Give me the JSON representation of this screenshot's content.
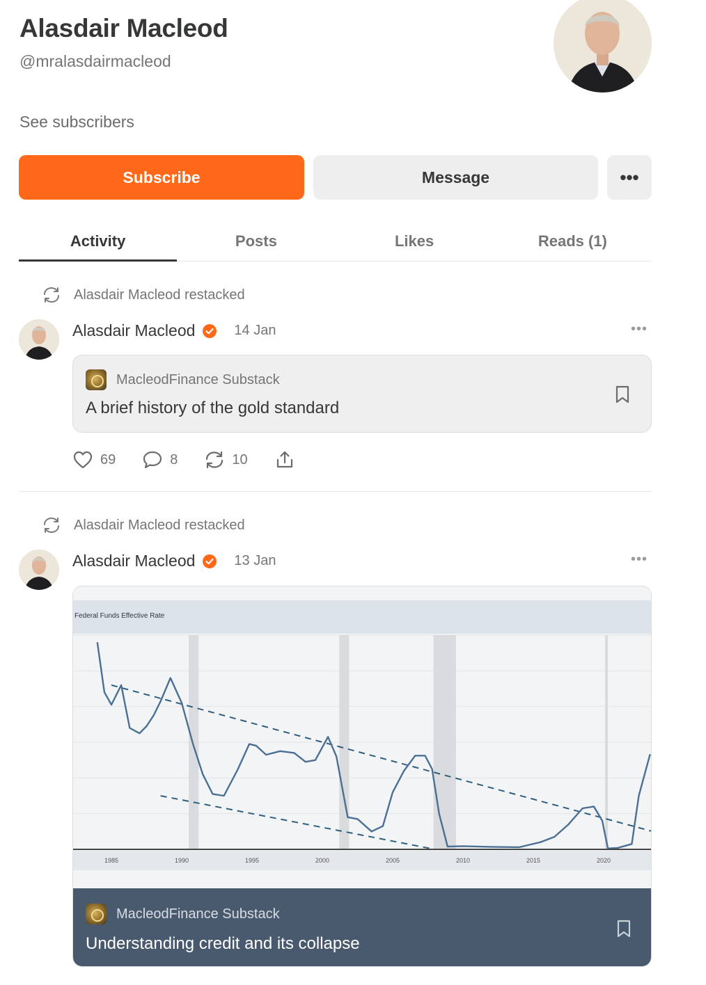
{
  "profile": {
    "name": "Alasdair Macleod",
    "handle": "@mralasdairmacleod",
    "see_subscribers": "See subscribers"
  },
  "buttons": {
    "subscribe": "Subscribe",
    "message": "Message",
    "more": "•••"
  },
  "tabs": [
    {
      "label": "Activity",
      "active": true
    },
    {
      "label": "Posts",
      "active": false
    },
    {
      "label": "Likes",
      "active": false
    },
    {
      "label": "Reads (1)",
      "active": false
    }
  ],
  "feed": [
    {
      "restack_text": "Alasdair Macleod restacked",
      "author": "Alasdair Macleod",
      "date": "14 Jan",
      "publication": "MacleodFinance Substack",
      "title": "A brief history of the gold standard",
      "likes": "69",
      "comments": "8",
      "restacks": "10"
    },
    {
      "restack_text": "Alasdair Macleod restacked",
      "author": "Alasdair Macleod",
      "date": "13 Jan",
      "publication": "MacleodFinance Substack",
      "title": "Understanding credit and its collapse",
      "chart_title": "Federal Funds Effective Rate",
      "chart_ticks": [
        "1985",
        "1990",
        "1995",
        "2000",
        "2005",
        "2010",
        "2015",
        "2020"
      ]
    }
  ],
  "colors": {
    "accent": "#ff6719",
    "card_footer": "#4a5a6e",
    "chart_line": "#4a6f95"
  },
  "chart_data": {
    "type": "line",
    "title": "Federal Funds Effective Rate",
    "xlabel": "",
    "ylabel": "",
    "xlim": [
      1984,
      2024
    ],
    "ylim": [
      0,
      12
    ],
    "grid": true,
    "x": [
      1984,
      1984.5,
      1985,
      1985.7,
      1986.3,
      1987,
      1987.5,
      1988,
      1988.5,
      1989.2,
      1990,
      1990.8,
      1991.5,
      1992.2,
      1993,
      1994,
      1994.8,
      1995.3,
      1996,
      1997,
      1998,
      1998.8,
      1999.5,
      2000.4,
      2001,
      2001.8,
      2002.5,
      2003.5,
      2004.3,
      2005,
      2005.8,
      2006.6,
      2007.3,
      2007.8,
      2008.3,
      2008.9,
      2010,
      2012,
      2014,
      2015.5,
      2016.5,
      2017.5,
      2018.5,
      2019.3,
      2019.9,
      2020.3,
      2021,
      2022,
      2022.5,
      2023.3
    ],
    "values": [
      11.6,
      8.8,
      8.1,
      9.2,
      6.8,
      6.5,
      6.9,
      7.5,
      8.3,
      9.6,
      8.2,
      5.9,
      4.2,
      3.1,
      3.0,
      4.5,
      5.9,
      5.8,
      5.3,
      5.5,
      5.4,
      4.9,
      5.0,
      6.3,
      5.2,
      1.8,
      1.7,
      1.0,
      1.3,
      3.2,
      4.4,
      5.25,
      5.25,
      4.5,
      2.0,
      0.16,
      0.18,
      0.14,
      0.12,
      0.4,
      0.7,
      1.4,
      2.3,
      2.4,
      1.6,
      0.05,
      0.08,
      0.3,
      3.0,
      5.33
    ],
    "trendlines": [
      {
        "x": [
          1985,
          2023.5
        ],
        "values": [
          9.2,
          1.0
        ]
      },
      {
        "x": [
          1988.5,
          2008
        ],
        "values": [
          3.0,
          0.0
        ]
      }
    ],
    "recessions": [
      [
        1990.5,
        1991.2
      ],
      [
        2001.2,
        2001.9
      ],
      [
        2007.9,
        2009.5
      ],
      [
        2020.1,
        2020.3
      ]
    ]
  }
}
